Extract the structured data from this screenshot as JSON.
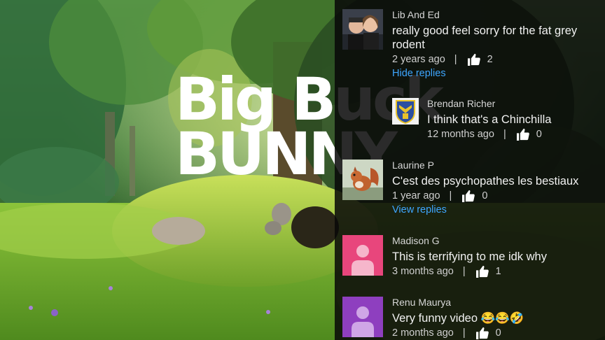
{
  "video": {
    "title_line1": "Big Buck",
    "title_line2": "BUNNY"
  },
  "comments": [
    {
      "author": "Lib And Ed",
      "text": "really good feel sorry for the fat grey rodent",
      "age": "2 years ago",
      "likes": "2",
      "replies_link": "Hide replies",
      "avatar": "photo-couple"
    },
    {
      "author": "Brendan Richer",
      "text": "I think that's a Chinchilla",
      "age": "12 months ago",
      "likes": "0",
      "avatar": "crest-emblem"
    },
    {
      "author": "Laurine P",
      "text": "C'est des psychopathes les bestiaux",
      "age": "1 year ago",
      "likes": "0",
      "replies_link": "View replies",
      "avatar": "photo-squirrel"
    },
    {
      "author": "Madison G",
      "text": "This is terrifying to me idk why",
      "age": "3 months ago",
      "likes": "1",
      "avatar": "default-person",
      "avatar_color": "#e8467c"
    },
    {
      "author": "Renu Maurya",
      "text": "Very funny video 😂😂🤣",
      "age": "2 months ago",
      "likes": "0",
      "avatar": "default-person",
      "avatar_color": "#8e3fbf"
    }
  ],
  "colors": {
    "link": "#3ea6ff",
    "panel_bg": "#080808"
  },
  "icons": [
    "thumb-up-icon",
    "person-icon"
  ]
}
